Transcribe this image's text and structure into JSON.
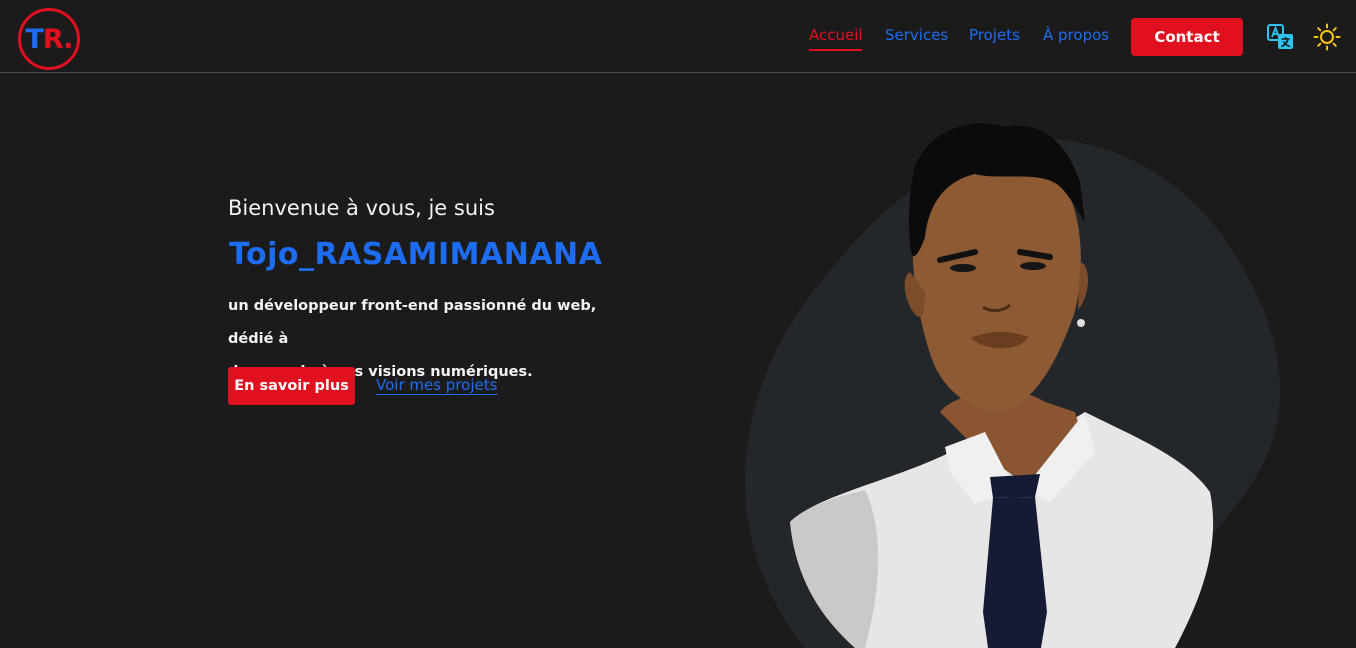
{
  "logo": {
    "initial_t": "T",
    "initial_r": "R."
  },
  "nav": {
    "items": [
      {
        "label": "Accueil",
        "active": true
      },
      {
        "label": "Services",
        "active": false
      },
      {
        "label": "Projets",
        "active": false
      },
      {
        "label": "À propos",
        "active": false
      }
    ],
    "contact_label": "Contact",
    "translate_icon": "translate-icon",
    "theme_icon": "sun-icon"
  },
  "hero": {
    "intro": "Bienvenue à vous, je suis",
    "name": "Tojo_RASAMIMANANA",
    "description_line1": "un développeur front-end passionné du web, dédié à",
    "description_line2": "donner vie à vos visions numériques.",
    "primary_button": "En savoir plus",
    "secondary_link": "Voir mes projets"
  },
  "colors": {
    "background": "#1b1b1b",
    "accent_red": "#e0101f",
    "accent_blue": "#1e6cf2",
    "theme_icon_yellow": "#f5c518"
  }
}
